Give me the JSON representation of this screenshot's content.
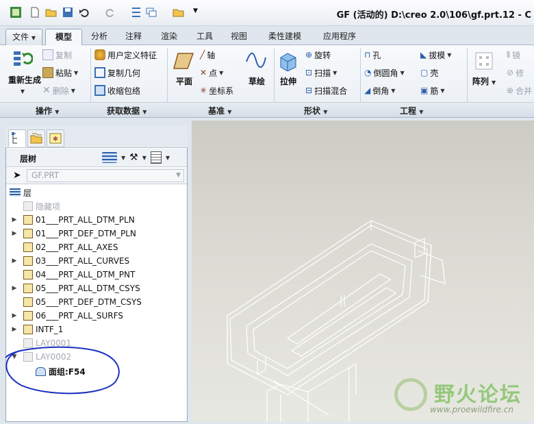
{
  "window": {
    "title": "GF (活动的) D:\\creo 2.0\\106\\gf.prt.12 - C"
  },
  "tabs": [
    "文件",
    "模型",
    "分析",
    "注释",
    "渲染",
    "工具",
    "视图",
    "柔性建模",
    "应用程序"
  ],
  "ribbon": {
    "operations": {
      "regen_label": "重新生成",
      "copy": "复制",
      "paste": "粘贴",
      "delete": "删除",
      "group": "操作"
    },
    "get_data": {
      "udf": "用户定义特征",
      "copy_geom": "复制几何",
      "shrinkwrap": "收缩包络",
      "group": "获取数据"
    },
    "datum": {
      "plane": "平面",
      "axis": "轴",
      "point": "点",
      "csys": "坐标系",
      "sketch": "草绘",
      "group": "基准"
    },
    "shapes": {
      "extrude": "拉伸",
      "revolve": "旋转",
      "sweep": "扫描",
      "swept_blend": "扫描混合",
      "group": "形状"
    },
    "engineering": {
      "hole": "孔",
      "round": "倒圆角",
      "chamfer": "倒角",
      "draft": "拔模",
      "shell": "壳",
      "rib": "筋",
      "group": "工程"
    },
    "edit": {
      "pattern": "阵列",
      "mirror": "镜",
      "modify": "修",
      "merge": "合并"
    }
  },
  "panel": {
    "header": "层树",
    "model": "GF.PRT",
    "root": "层",
    "items": [
      {
        "label": "隐藏项",
        "expander": "",
        "gray": true
      },
      {
        "label": "01___PRT_ALL_DTM_PLN",
        "expander": "▶",
        "gray": false
      },
      {
        "label": "01___PRT_DEF_DTM_PLN",
        "expander": "▶",
        "gray": false
      },
      {
        "label": "02___PRT_ALL_AXES",
        "expander": "",
        "gray": false
      },
      {
        "label": "03___PRT_ALL_CURVES",
        "expander": "▶",
        "gray": false
      },
      {
        "label": "04___PRT_ALL_DTM_PNT",
        "expander": "",
        "gray": false
      },
      {
        "label": "05___PRT_ALL_DTM_CSYS",
        "expander": "▶",
        "gray": false
      },
      {
        "label": "05___PRT_DEF_DTM_CSYS",
        "expander": "",
        "gray": false
      },
      {
        "label": "06___PRT_ALL_SURFS",
        "expander": "▶",
        "gray": false
      },
      {
        "label": "INTF_1",
        "expander": "▶",
        "gray": false
      },
      {
        "label": "LAY0001",
        "expander": "",
        "gray": true
      },
      {
        "label": "LAY0002",
        "expander": "▼",
        "gray": true
      }
    ],
    "child": "面组:F54"
  },
  "watermark": {
    "text": "野火论坛",
    "url": "www.proewildfire.cn"
  },
  "colors": {
    "annotation": "#1a2fbf",
    "viewport_bg": "#d6d6cf",
    "wireframe": "#ffffff"
  }
}
